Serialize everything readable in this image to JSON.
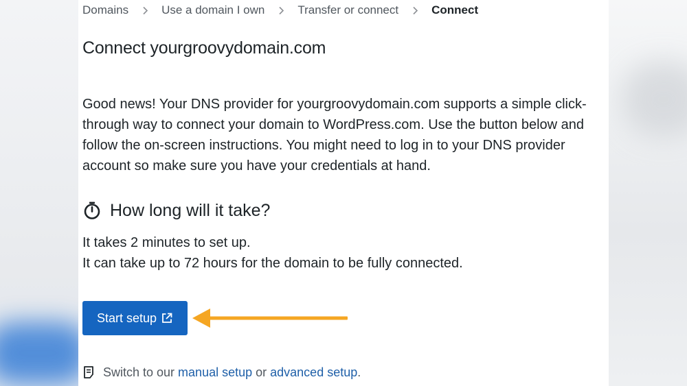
{
  "breadcrumb": {
    "items": [
      "Domains",
      "Use a domain I own",
      "Transfer or connect",
      "Connect"
    ]
  },
  "title": "Connect yourgroovydomain.com",
  "description": "Good news! Your DNS provider for yourgroovydomain.com supports a simple click-through way to connect your domain to WordPress.com. Use the button below and follow the on-screen instructions. You might need to log in to your DNS provider account so make sure you have your credentials at hand.",
  "timing": {
    "heading": "How long will it take?",
    "icon": "stopwatch-icon",
    "line1": "It takes 2 minutes to set up.",
    "line2": "It can take up to 72 hours for the domain to be fully connected."
  },
  "start_button": {
    "label": "Start setup",
    "icon": "external-link-icon"
  },
  "annotation": {
    "arrow_color": "#f5a623"
  },
  "footer": {
    "icon": "document-icon",
    "prefix": "Switch to our ",
    "manual_link": "manual setup",
    "middle": " or ",
    "advanced_link": "advanced setup",
    "suffix": "."
  },
  "colors": {
    "primary_button": "#1565c0",
    "link": "#1e5fa8",
    "text": "#1d2327"
  }
}
